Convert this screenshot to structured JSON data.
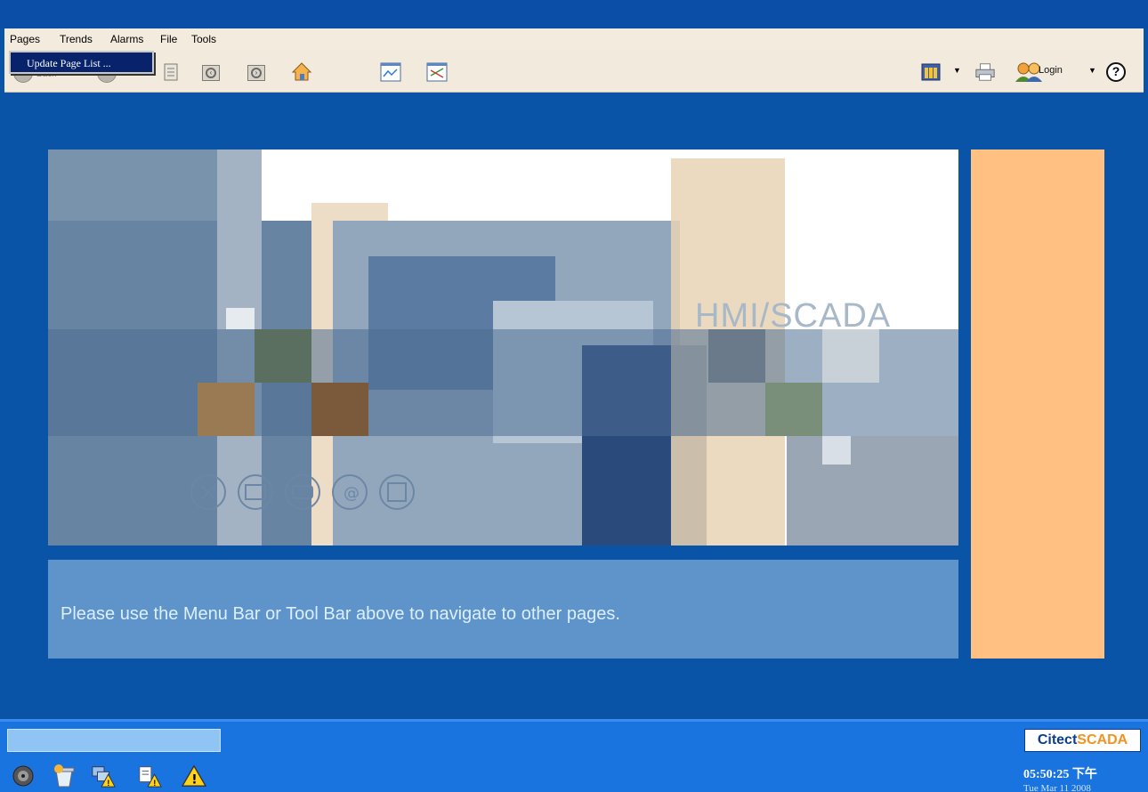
{
  "menubar": {
    "items": [
      {
        "label": "Pages"
      },
      {
        "label": "Trends"
      },
      {
        "label": "Alarms"
      },
      {
        "label": "File"
      },
      {
        "label": "Tools"
      }
    ]
  },
  "dropdown": {
    "item": "Update Page List ..."
  },
  "toolbar": {
    "back_label": "Back",
    "login_label": "Login",
    "help_glyph": "?"
  },
  "banner": {
    "text": "HMI/SCADA"
  },
  "message": {
    "text": "Please use the Menu Bar or Tool Bar above to navigate to other pages."
  },
  "statusbar": {
    "brand_part1": "Citect",
    "brand_part2": "SCADA",
    "time": "05:50:25 下午",
    "date": "Tue Mar 11 2008"
  },
  "colors": {
    "background": "#0a54a8",
    "menubar": "#f3ebdd",
    "side_panel": "#ffc081",
    "message_bar": "#5f94cb",
    "statusbar": "#1a74e0",
    "brand_orange": "#f39220",
    "brand_navy": "#0c3c8a"
  }
}
